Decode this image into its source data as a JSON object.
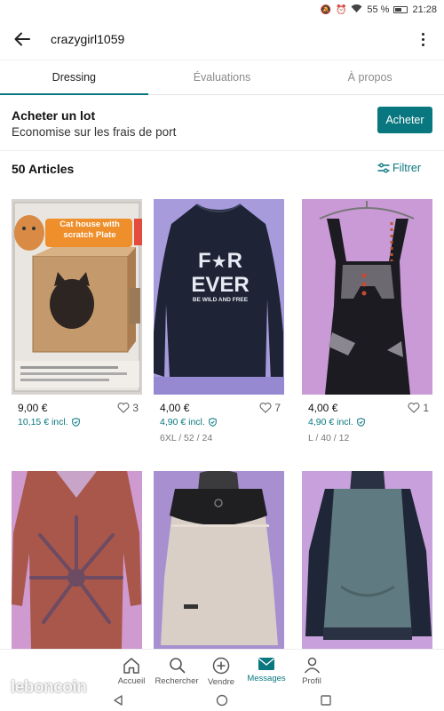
{
  "status_bar": {
    "battery": "55 %",
    "time": "21:28"
  },
  "header": {
    "title": "crazygirl1059"
  },
  "tabs": [
    {
      "label": "Dressing",
      "active": true
    },
    {
      "label": "Évaluations",
      "active": false
    },
    {
      "label": "À propos",
      "active": false
    }
  ],
  "bundle": {
    "title": "Acheter un lot",
    "subtitle": "Economise sur les frais de port",
    "button_label": "Acheter"
  },
  "items_header": {
    "count_label": "50 Articles",
    "filter_label": "Filtrer"
  },
  "items": [
    {
      "price": "9,00 €",
      "price_incl": "10,15 € incl.",
      "favorites": "3",
      "sizes": "",
      "photo_text": [
        "Cat house with",
        "scratch Plate"
      ]
    },
    {
      "price": "4,00 €",
      "price_incl": "4,90 € incl.",
      "favorites": "7",
      "sizes": "6XL / 52 / 24",
      "photo_text": [
        "F",
        "R",
        "EVER",
        "BE WILD AND FREE"
      ]
    },
    {
      "price": "4,00 €",
      "price_incl": "4,90 € incl.",
      "favorites": "1",
      "sizes": "L / 40 / 12"
    },
    {
      "price": "",
      "price_incl": "",
      "favorites": "",
      "sizes": ""
    },
    {
      "price": "",
      "price_incl": "",
      "favorites": "",
      "sizes": ""
    },
    {
      "price": "",
      "price_incl": "",
      "favorites": "",
      "sizes": ""
    }
  ],
  "bottom_nav": [
    {
      "label": "Accueil",
      "icon": "home-icon",
      "active": false
    },
    {
      "label": "Rechercher",
      "icon": "search-icon",
      "active": false
    },
    {
      "label": "Vendre",
      "icon": "plus-circle-icon",
      "active": false
    },
    {
      "label": "Messages",
      "icon": "envelope-icon",
      "active": true
    },
    {
      "label": "Profil",
      "icon": "person-icon",
      "active": false
    }
  ],
  "watermark": "leboncoin",
  "colors": {
    "accent": "#09777f",
    "text": "#222222",
    "muted": "#8a8a8a"
  }
}
